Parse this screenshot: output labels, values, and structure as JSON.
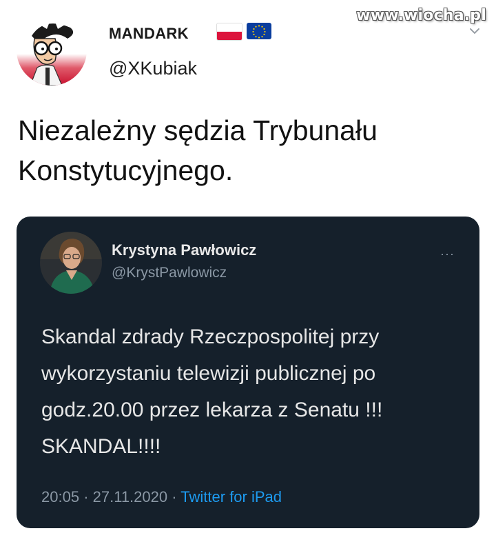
{
  "watermark": "www.wiocha.pl",
  "tweet": {
    "author_name": "MANDARK",
    "handle": "@XKubiak",
    "text": "Niezależny sędzia Trybunału Konstytucyjnego."
  },
  "quoted_tweet": {
    "author_name": "Krystyna Pawłowicz",
    "handle": "@KrystPawlowicz",
    "more": "···",
    "text": "Skandal zdrady Rzeczpospolitej przy wykorzystaniu telewizji publicznej po godz.20.00 przez lekarza z Senatu !!! SKANDAL!!!!",
    "time": "20:05",
    "separator": "·",
    "date": "27.11.2020",
    "source": "Twitter for iPad"
  },
  "colors": {
    "card_bg": "#15202b",
    "secondary_text": "#8b98a5",
    "link_blue": "#1d9bf0"
  },
  "icons": [
    "avatar-cartoon",
    "flag-poland-icon",
    "flag-eu-icon",
    "chevron-down-icon",
    "more-icon"
  ]
}
